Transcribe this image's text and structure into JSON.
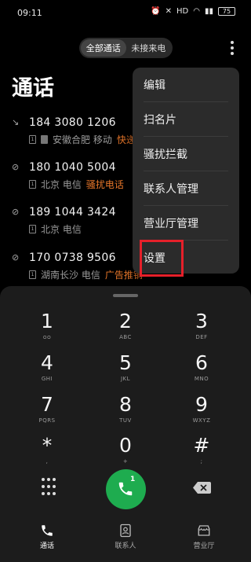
{
  "status_bar": {
    "time": "09:11",
    "network": "HD",
    "battery": "75"
  },
  "tabs": {
    "all_calls": "全部通话",
    "missed": "未接来电"
  },
  "page_title": "通话",
  "calls": [
    {
      "number": "184 3080 1206",
      "location": "安徽合肥 移动",
      "tag": "快递"
    },
    {
      "number": "180 1040 5004",
      "location": "北京 电信",
      "tag": "骚扰电话"
    },
    {
      "number": "189 1044 3424",
      "location": "北京 电信",
      "tag": ""
    },
    {
      "number": "170 0738 9506",
      "location": "湖南长沙 电信",
      "tag": "广告推销"
    }
  ],
  "menu": {
    "items": [
      "编辑",
      "扫名片",
      "骚扰拦截",
      "联系人管理",
      "营业厅管理",
      "设置"
    ]
  },
  "keypad": [
    {
      "digit": "1",
      "letters": "ᴑᴑ"
    },
    {
      "digit": "2",
      "letters": "ABC"
    },
    {
      "digit": "3",
      "letters": "DEF"
    },
    {
      "digit": "4",
      "letters": "GHI"
    },
    {
      "digit": "5",
      "letters": "JKL"
    },
    {
      "digit": "6",
      "letters": "MNO"
    },
    {
      "digit": "7",
      "letters": "PQRS"
    },
    {
      "digit": "8",
      "letters": "TUV"
    },
    {
      "digit": "9",
      "letters": "WXYZ"
    },
    {
      "digit": "*",
      "letters": ","
    },
    {
      "digit": "0",
      "letters": "+"
    },
    {
      "digit": "#",
      "letters": ";"
    }
  ],
  "call_button": {
    "sim": "1"
  },
  "bottom_nav": {
    "calls": "通话",
    "contacts": "联系人",
    "service": "营业厅"
  },
  "colors": {
    "accent_green": "#1eac4f",
    "spam_orange": "#e8772a",
    "highlight_red": "#e5202a"
  }
}
